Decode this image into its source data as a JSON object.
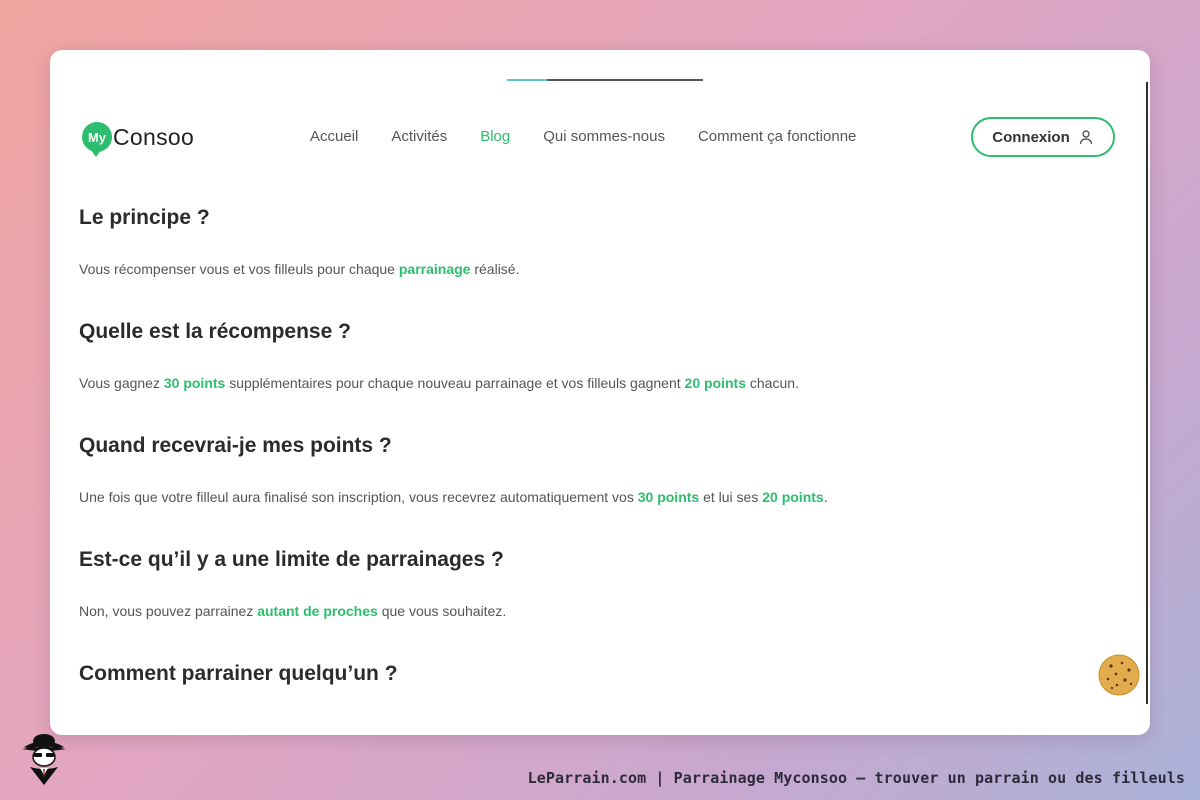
{
  "header": {
    "logo_badge": "My",
    "logo_text": "Consoo",
    "nav": [
      {
        "label": "Accueil",
        "active": false
      },
      {
        "label": "Activités",
        "active": false
      },
      {
        "label": "Blog",
        "active": true
      },
      {
        "label": "Qui sommes-nous",
        "active": false
      },
      {
        "label": "Comment ça fonctionne",
        "active": false
      }
    ],
    "login_label": "Connexion",
    "login_icon": "user-icon"
  },
  "sections": [
    {
      "title": "Le principe ?",
      "text": {
        "t1": "Vous récompenser vous et vos filleuls pour chaque ",
        "h1": "parrainage",
        "t2": " réalisé."
      }
    },
    {
      "title": "Quelle est la récompense ?",
      "text": {
        "t1": "Vous gagnez ",
        "h1": "30 points",
        "t2": " supplémentaires pour chaque nouveau parrainage et vos filleuls gagnent ",
        "h2": "20 points",
        "t3": " chacun."
      }
    },
    {
      "title": "Quand recevrai-je mes points ?",
      "text": {
        "t1": "Une fois que votre filleul aura finalisé son inscription, vous recevrez automatiquement vos ",
        "h1": "30 points",
        "t2": " et lui ses ",
        "h2": "20 points",
        "t3": "."
      }
    },
    {
      "title": "Est-ce qu’il y a une limite de parrainages ?",
      "text": {
        "t1": "Non, vous pouvez parrainez ",
        "h1": "autant de proches",
        "t2": " que vous souhaitez."
      }
    },
    {
      "title": "Comment parrainer quelqu’un ?"
    }
  ],
  "cookie_icon": "cookie-icon",
  "footer": {
    "caption": "LeParrain.com | Parrainage Myconsoo — trouver un parrain ou des filleuls",
    "logo_icon": "spy-mascot-icon"
  },
  "colors": {
    "accent": "#2dbd6e",
    "heading": "#2b2b2b",
    "body_text": "#555555"
  }
}
